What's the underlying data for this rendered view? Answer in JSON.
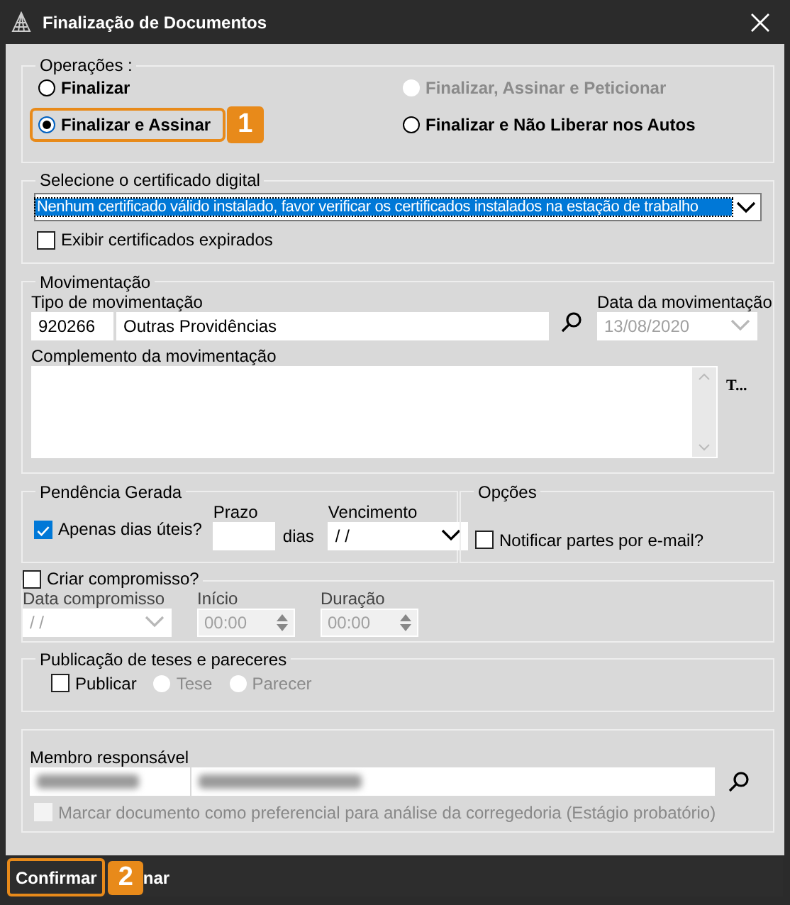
{
  "window": {
    "title": "Finalização de Documentos"
  },
  "operations": {
    "legend": "Operações :",
    "options": [
      {
        "label": "Finalizar",
        "selected": false,
        "disabled": false
      },
      {
        "label": "Finalizar, Assinar e Peticionar",
        "selected": false,
        "disabled": true
      },
      {
        "label": "Finalizar e Assinar",
        "selected": true,
        "disabled": false,
        "callout": "1"
      },
      {
        "label": "Finalizar e Não Liberar nos Autos",
        "selected": false,
        "disabled": false
      }
    ]
  },
  "certificate": {
    "legend": "Selecione o certificado digital",
    "value": "Nenhum certificado válido instalado, favor verificar os certificados instalados na estação de trabalho",
    "show_expired": {
      "label": "Exibir certificados expirados",
      "checked": false
    }
  },
  "movement": {
    "legend": "Movimentação",
    "type_label": "Tipo de movimentação",
    "type_code": "920266",
    "type_name": "Outras Providências",
    "date_label": "Data da movimentação",
    "date": "13/08/2020",
    "complement_label": "Complemento da movimentação",
    "side_text": "T..."
  },
  "pending": {
    "legend": "Pendência Gerada",
    "business_days": {
      "label": "Apenas dias úteis?",
      "checked": true
    },
    "term_label": "Prazo",
    "days": "dias",
    "due_label": "Vencimento",
    "due": "/ /"
  },
  "options": {
    "legend": "Opções",
    "notify": {
      "label": "Notificar partes por e-mail?",
      "checked": false
    }
  },
  "appointment": {
    "create": {
      "label": "Criar compromisso?",
      "checked": false
    },
    "date_label": "Data compromisso",
    "date": "/ /",
    "start_label": "Início",
    "start": "00:00",
    "duration_label": "Duração",
    "duration": "00:00"
  },
  "publication": {
    "legend": "Publicação de teses e pareceres",
    "publish": {
      "label": "Publicar",
      "checked": false
    },
    "types": [
      {
        "label": "Tese",
        "selected": false
      },
      {
        "label": "Parecer",
        "selected": false
      }
    ]
  },
  "member": {
    "label": "Membro responsável",
    "preferential": {
      "label": "Marcar documento como preferencial para análise da corregedoria (Estágio probatório)",
      "checked": false,
      "disabled": true
    }
  },
  "footer": {
    "confirm": "Confirmar",
    "confirm_callout": "2",
    "cancel_visible": "nar"
  }
}
